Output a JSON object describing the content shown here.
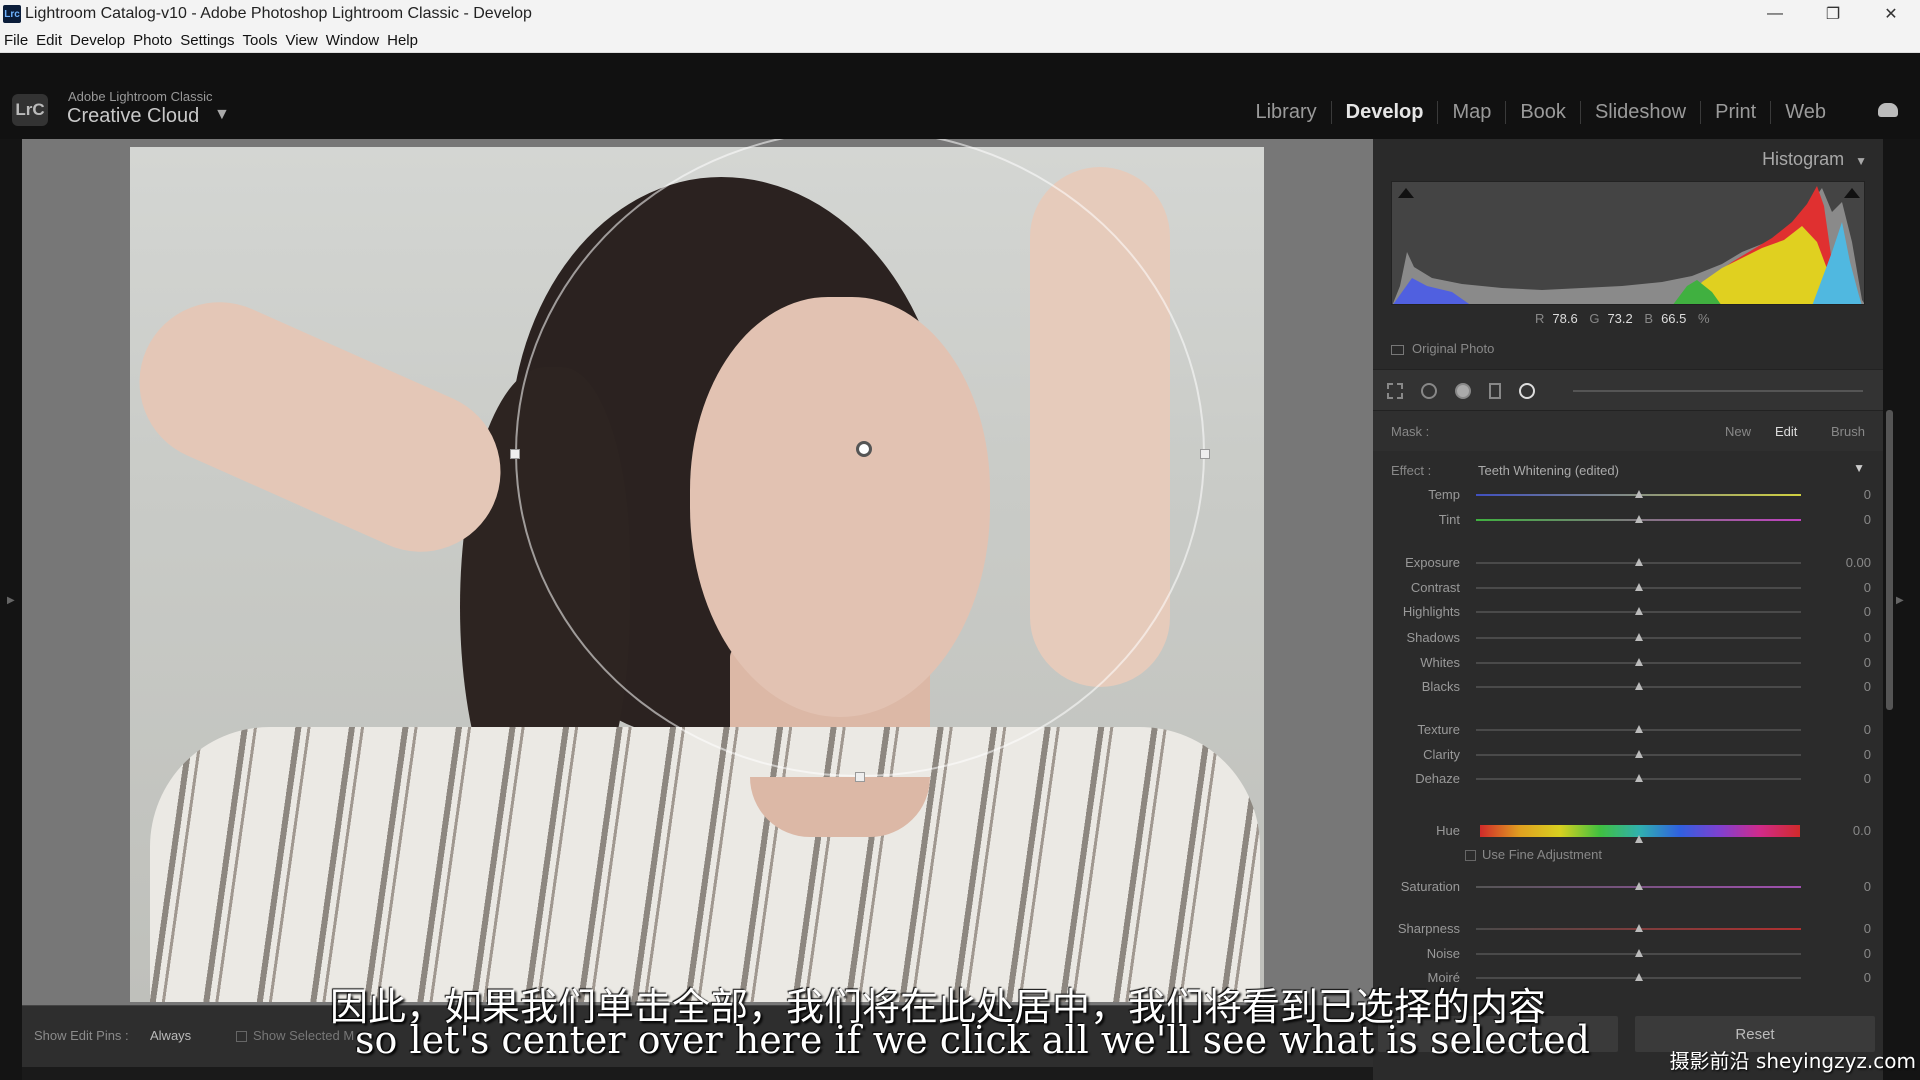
{
  "window": {
    "title": "Lightroom Catalog-v10 - Adobe Photoshop Lightroom Classic - Develop",
    "icon_label": "Lrc",
    "minimize": "—",
    "restore": "❐",
    "close": "✕"
  },
  "menu": [
    "File",
    "Edit",
    "Develop",
    "Photo",
    "Settings",
    "Tools",
    "View",
    "Window",
    "Help"
  ],
  "identity": {
    "badge": "LrC",
    "small": "Adobe Lightroom Classic",
    "big": "Creative Cloud",
    "arrow": "▼"
  },
  "modules": [
    {
      "label": "Library",
      "active": false
    },
    {
      "label": "Develop",
      "active": true
    },
    {
      "label": "Map",
      "active": false
    },
    {
      "label": "Book",
      "active": false
    },
    {
      "label": "Slideshow",
      "active": false
    },
    {
      "label": "Print",
      "active": false
    },
    {
      "label": "Web",
      "active": false
    }
  ],
  "toolbar": {
    "show_pins_label": "Show Edit Pins :",
    "show_pins_value": "Always",
    "show_selected": "Show Selected M"
  },
  "histogram": {
    "title": "Histogram",
    "title_arrow": "▼",
    "r_label": "R",
    "r": "78.6",
    "g_label": "G",
    "g": "73.2",
    "b_label": "B",
    "b": "66.5",
    "unit": "%",
    "original_photo": "Original Photo"
  },
  "mask": {
    "label": "Mask :",
    "new": "New",
    "edit": "Edit",
    "brush": "Brush"
  },
  "effect": {
    "label": "Effect :",
    "value": "Teeth Whitening (edited)",
    "arrow": "▼"
  },
  "sliders": [
    {
      "name": "Temp",
      "value": "0"
    },
    {
      "name": "Tint",
      "value": "0"
    },
    {
      "name": "Exposure",
      "value": "0.00"
    },
    {
      "name": "Contrast",
      "value": "0"
    },
    {
      "name": "Highlights",
      "value": "0"
    },
    {
      "name": "Shadows",
      "value": "0"
    },
    {
      "name": "Whites",
      "value": "0"
    },
    {
      "name": "Blacks",
      "value": "0"
    },
    {
      "name": "Texture",
      "value": "0"
    },
    {
      "name": "Clarity",
      "value": "0"
    },
    {
      "name": "Dehaze",
      "value": "0"
    },
    {
      "name": "Hue",
      "value": "0.0"
    },
    {
      "name": "Saturation",
      "value": "0"
    },
    {
      "name": "Sharpness",
      "value": "0"
    },
    {
      "name": "Noise",
      "value": "0"
    },
    {
      "name": "Moiré",
      "value": "0"
    }
  ],
  "fine_adjustment": "Use Fine Adjustment",
  "buttons": {
    "reset": "Reset"
  },
  "subtitles": {
    "zh": "因此，如果我们单击全部，我们将在此处居中，我们将看到已选择的内容",
    "en": "so let's center over here if we click all we'll see what is selected"
  },
  "watermark": "摄影前沿 sheyingzyz.com",
  "colors": {
    "accent": "#e6e6e6",
    "panel": "#2a2a2a",
    "hist_red": "#e03030",
    "hist_yellow": "#e0d020",
    "hist_cyan": "#30b0d0"
  }
}
